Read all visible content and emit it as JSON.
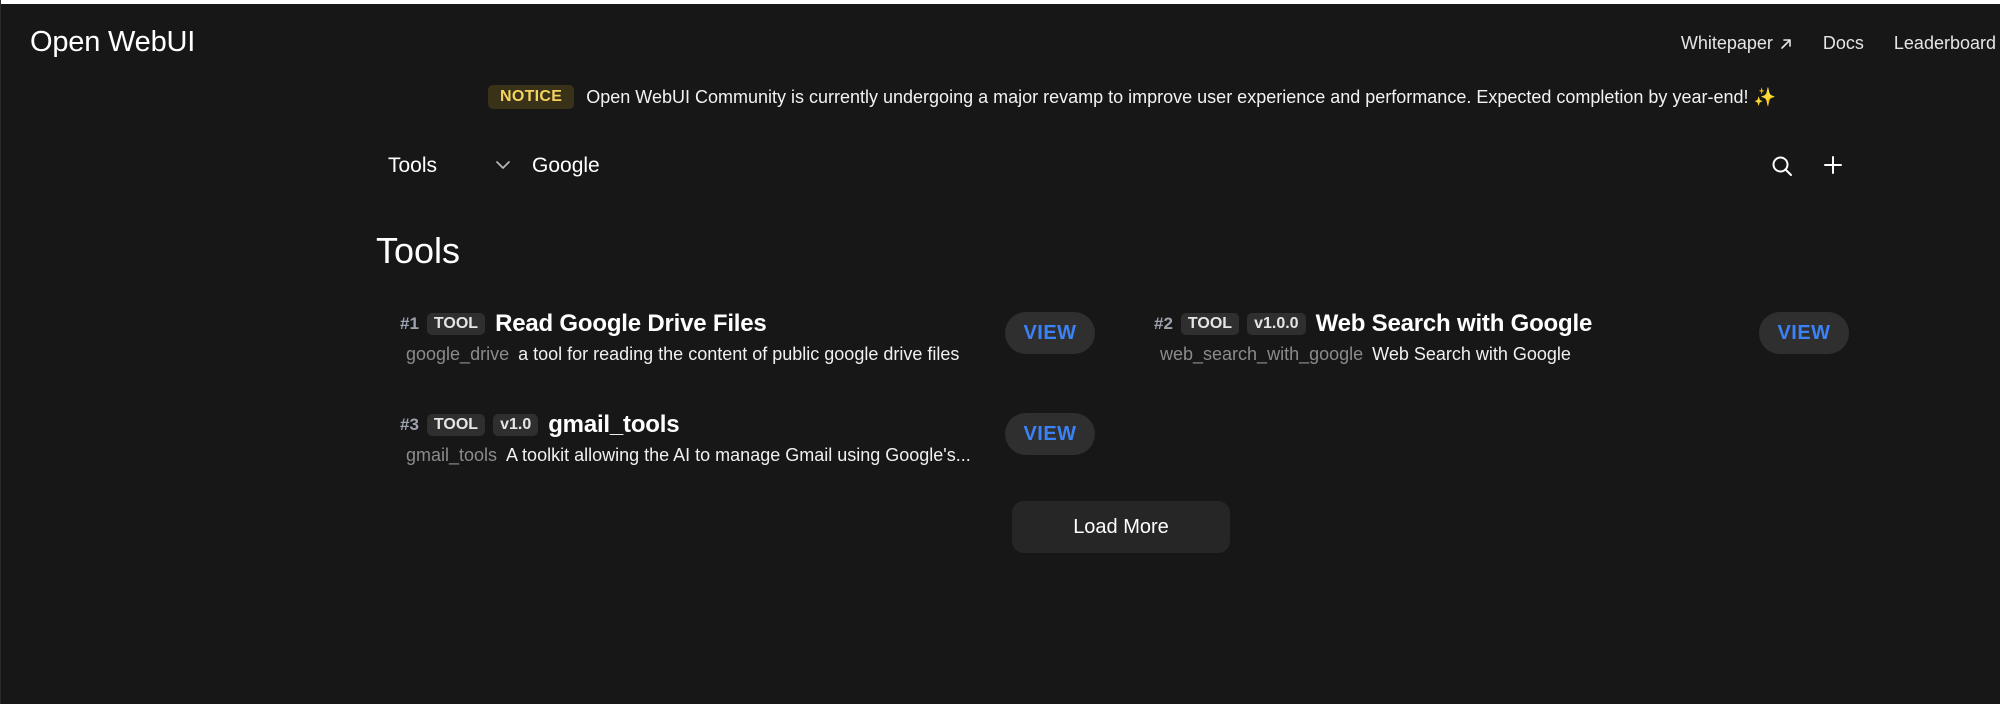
{
  "header": {
    "brand": "Open WebUI",
    "nav": [
      {
        "label": "Whitepaper",
        "icon": "external-arrow-icon"
      },
      {
        "label": "Docs"
      },
      {
        "label": "Leaderboard"
      }
    ]
  },
  "notice": {
    "badge": "NOTICE",
    "text": "Open WebUI Community is currently undergoing a major revamp to improve user experience and performance. Expected completion by year-end! ✨"
  },
  "filter": {
    "type_selected": "Tools",
    "search_value": "Google"
  },
  "section_title": "Tools",
  "tools": [
    {
      "rank": "#1",
      "tag": "TOOL",
      "version": "",
      "name": "Read Google Drive Files",
      "id": "google_drive",
      "description": "a tool for reading the content of public google drive files",
      "action": "VIEW"
    },
    {
      "rank": "#2",
      "tag": "TOOL",
      "version": "v1.0.0",
      "name": "Web Search with Google",
      "id": "web_search_with_google",
      "description": "Web Search with Google",
      "action": "VIEW"
    },
    {
      "rank": "#3",
      "tag": "TOOL",
      "version": "v1.0",
      "name": "gmail_tools",
      "id": "gmail_tools",
      "description": "A toolkit allowing the AI to manage Gmail using Google's...",
      "action": "VIEW"
    }
  ],
  "load_more": "Load More",
  "colors": {
    "background": "#171717",
    "accent": "#3b82f6",
    "notice_badge_bg": "#3a3218",
    "notice_badge_text": "#f4d35e",
    "tag_bg": "#2f2f2f"
  }
}
